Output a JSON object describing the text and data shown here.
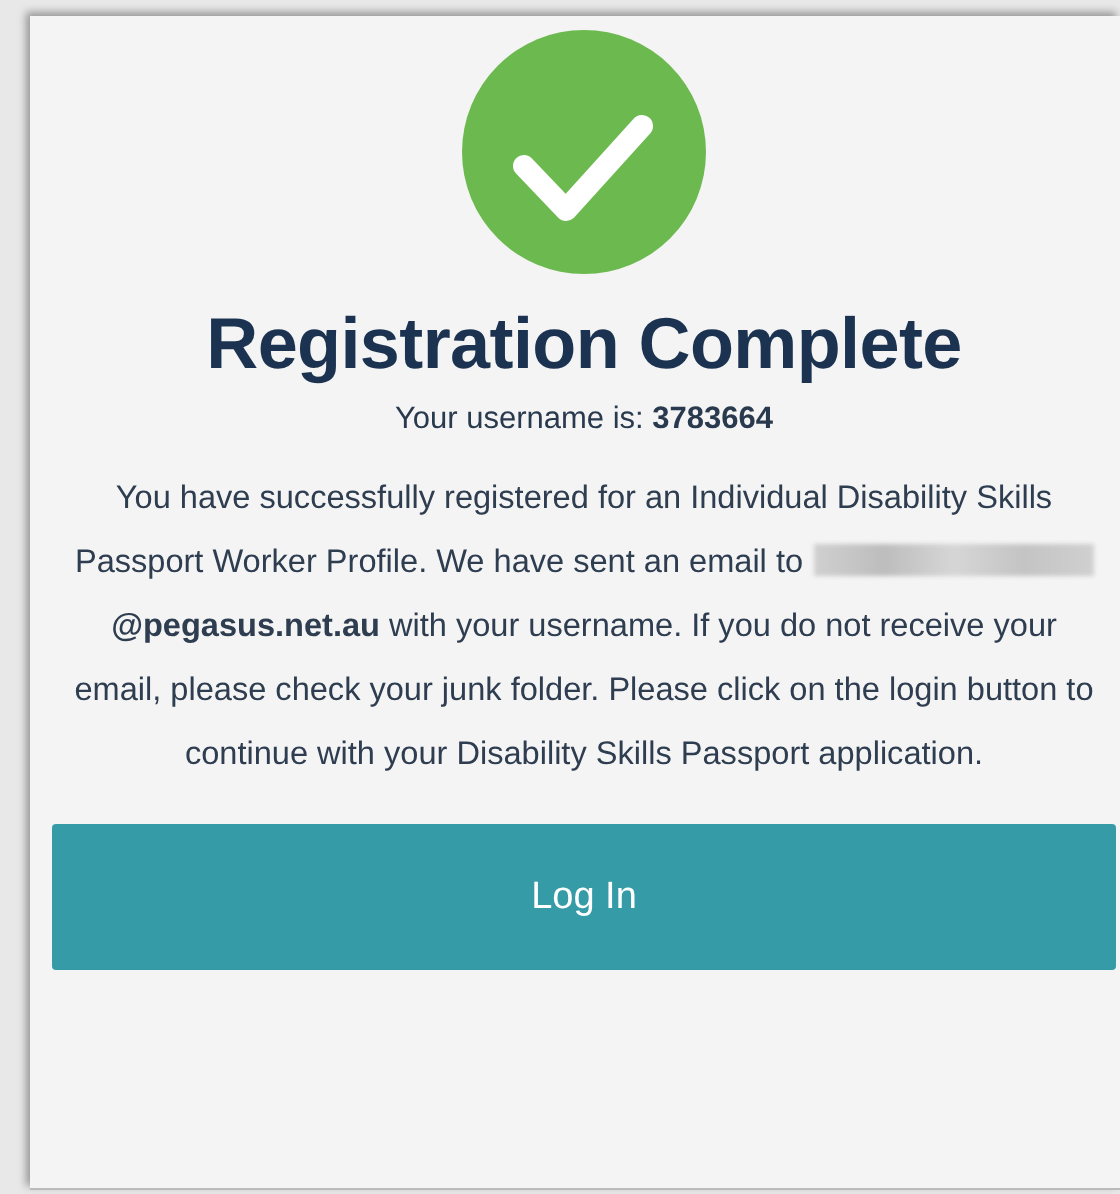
{
  "status": {
    "kind": "success"
  },
  "title": "Registration Complete",
  "username_line": "Your username is: **3783664**",
  "message": {
    "before_email": "You have successfully registered for an Individual Disability Skills Passport Worker Profile. We have sent an email to",
    "email_redacted": true,
    "after_email": "**@pegasus.net.au** with your username. If you do not receive your email, please check your junk folder. Please click on the login button to continue with your Disability Skills Passport application."
  },
  "button": {
    "label": "Log In"
  }
}
